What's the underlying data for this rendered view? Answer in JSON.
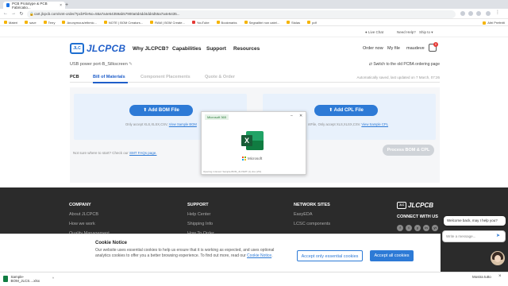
{
  "browser": {
    "tabs": [
      {
        "label": "PCB Prototype & PCB Fabricatio...",
        "active": true
      },
      {
        "label": "Online Gerber Viewer",
        "active": false
      }
    ],
    "url": "cart.jlcpcb.com/smt-order/?pcbFileNo=55a7a4e54359ab57900a0d4dd4dd4d55a7a4e5435...",
    "bookmarks": [
      "Materi",
      "save",
      "Terry",
      "Anonymous/ethmic...",
      "NOTE | BOM Creators...",
      "RAM | BOM Create...",
      "YouTube",
      "Bookmarks",
      "Segnalibri non catel...",
      "Stolas",
      "pdf"
    ],
    "bookmarks_right": "Altri Preferiti"
  },
  "topstrip": {
    "live_chat": "Live Chat",
    "need_help": "Need Help?",
    "ship_to": "Ship to"
  },
  "header": {
    "logo_badge": "JLC",
    "logo_word": "JLCPCB",
    "nav": [
      "Why JLCPCB?",
      "Capabilities",
      "Support",
      "Resources"
    ],
    "order_now": "Order now",
    "my_file": "My file",
    "user": "maudeve",
    "cart_count": "0"
  },
  "project": {
    "name": "USB power port-B_Silkscreen",
    "edit_icon": "pencil-icon",
    "old_pcba": "Switch to the old PCBA ordering page"
  },
  "tabs": {
    "items": [
      "PCB",
      "Bill of Materials",
      "Component Placements",
      "Quote & Order"
    ],
    "autosave": "Automatically saved, last updated on 7 March, 07:26"
  },
  "upload": {
    "bom_button": "Add BOM File",
    "bom_hint": "Only accept XLS,XLSX,CSV,",
    "bom_link": "View Sample BOM",
    "cpl_button": "Add CPL File",
    "cpl_hint": "ntFile, Only accept XLS,XLSX,CSV.",
    "cpl_link": "View Sample CPL",
    "not_sure": "Not sure where to start? Check our",
    "not_sure_link": "SMT FAQs page.",
    "process_button": "Process BOM & CPL"
  },
  "splash": {
    "badge": "Microsoft 365",
    "app_letter": "X",
    "brand": "Microsoft",
    "footer": "Opening in Excel: Sample-BOM_JLCSMT (1).xlsx (2%)"
  },
  "footer": {
    "company_head": "COMPANY",
    "company_links": [
      "About JLCPCB",
      "How we work",
      "Quality Management"
    ],
    "support_head": "SUPPORT",
    "support_links": [
      "Help Center",
      "Shipping Info",
      "How To Order"
    ],
    "network_head": "NETWORK SITES",
    "network_links": [
      "EasyEDA",
      "LCSC components"
    ],
    "logo_badge": "JLC",
    "logo_word": "JLCPCB",
    "connect": "CONNECT WITH US",
    "social": [
      "f",
      "t",
      "y",
      "in",
      "yt"
    ]
  },
  "cookie": {
    "title": "Cookie Notice",
    "text": "Our website uses essential cookies to help us ensure that it is working as expected, and uses optional analytics cookies to offer you a better browsing experience. To find out more, read our",
    "link": "Cookie Notice",
    "btn_essential": "Accept only essential cookies",
    "btn_all": "Accept all cookies"
  },
  "chat": {
    "bubble": "Welcome back, may I help you?",
    "placeholder": "Write a message..."
  },
  "downloads": {
    "file": "Sample-BOM_JLCS....xlsx",
    "show_all": "Mostra tutto"
  }
}
